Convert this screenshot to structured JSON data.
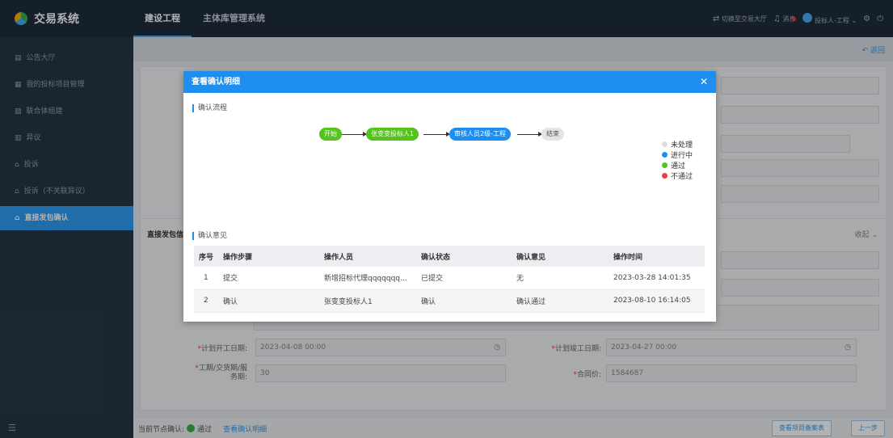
{
  "app": {
    "title": "交易系统"
  },
  "topnav": {
    "tabs": [
      "建设工程",
      "主体库管理系统"
    ]
  },
  "topright": {
    "switch_label": "切换至交易大厅",
    "messages_label": "消息",
    "user_label": "投标人-工程"
  },
  "sidebar": {
    "items": [
      {
        "label": "公告大厅",
        "icon": "doc-icon"
      },
      {
        "label": "我的投标项目管理",
        "icon": "project-icon"
      },
      {
        "label": "联合体组建",
        "icon": "group-icon"
      },
      {
        "label": "异议",
        "icon": "objection-icon"
      },
      {
        "label": "投诉",
        "icon": "complaint-icon"
      },
      {
        "label": "投诉（不关联异议）",
        "icon": "complaint-icon"
      },
      {
        "label": "直接发包确认",
        "icon": "confirm-icon"
      }
    ]
  },
  "main": {
    "back_label": "返回",
    "section_title": "直接发包信",
    "collapse_label": "收起",
    "form": {
      "planned_start_label": "计划开工日期:",
      "planned_start_value": "2023-04-08 00:00",
      "planned_end_label": "计划竣工日期:",
      "planned_end_value": "2023-04-27 00:00",
      "duration_label": "工期/交货期/服务期:",
      "duration_value": "30",
      "contract_label": "合同价:",
      "contract_value": "1584687"
    }
  },
  "footer": {
    "node_label": "当前节点确认:",
    "status": "通过",
    "detail_link": "查看确认明细",
    "record_button": "查看项目备案表",
    "prev_button": "上一步"
  },
  "modal": {
    "title": "查看确认明细",
    "flow_title": "确认流程",
    "flow_nodes": [
      "开始",
      "张变变投标人1",
      "审核人员2级-工程",
      "结束"
    ],
    "legend": [
      {
        "label": "未处理",
        "color": "#dcdcdc"
      },
      {
        "label": "进行中",
        "color": "#1e8ff0"
      },
      {
        "label": "通过",
        "color": "#52c41a"
      },
      {
        "label": "不通过",
        "color": "#f03e3e"
      }
    ],
    "opinion_title": "确认意见",
    "table": {
      "headers": [
        "序号",
        "操作步骤",
        "操作人员",
        "确认状态",
        "确认意见",
        "操作时间"
      ],
      "rows": [
        [
          "1",
          "提交",
          "新增招标代理qqqqqqq...",
          "已提交",
          "无",
          "2023-03-28 14:01:35"
        ],
        [
          "2",
          "确认",
          "张变变投标人1",
          "确认",
          "确认通过",
          "2023-08-10 16:14:05"
        ]
      ]
    }
  }
}
